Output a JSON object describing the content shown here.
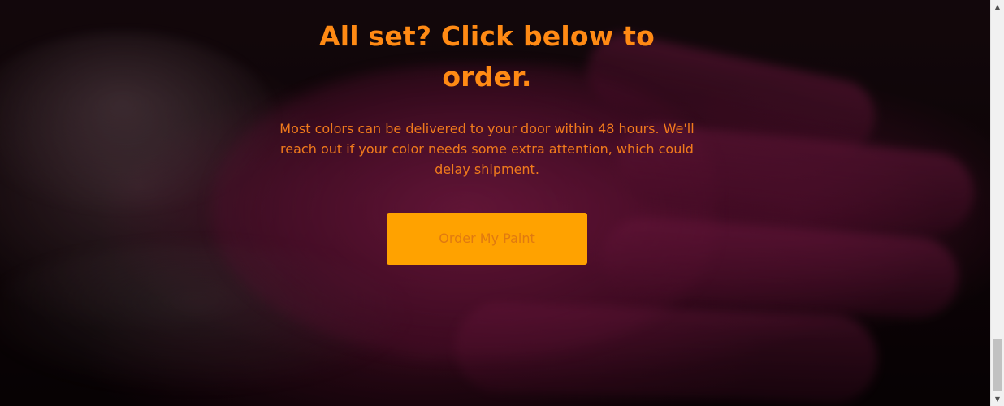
{
  "hero": {
    "headline": "All set? Click below to order.",
    "description": "Most colors can be delivered to your door within 48 hours. We'll reach out if your color needs some extra attention, which could delay shipment.",
    "order_button_label": "Order My Paint",
    "background_image": "pink-powder-hand-photo"
  },
  "colors": {
    "accent": "#ff8a14",
    "button": "#ffa200"
  },
  "scrollbar": {
    "up_arrow": "▲",
    "down_arrow": "▼"
  }
}
